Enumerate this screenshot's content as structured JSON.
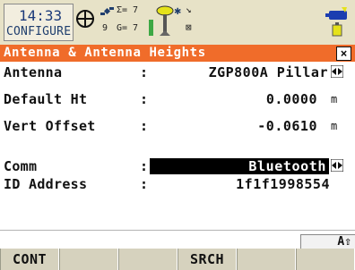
{
  "status": {
    "time": "14:33",
    "mode": "CONFIGURE",
    "satellites": {
      "gps_count_symbol": "Σ= 7",
      "glonass_count_symbol": "G= 7",
      "sv_number": "9"
    }
  },
  "title": {
    "text": "Antenna & Antenna Heights",
    "close_label": "×",
    "color": "#f06c2a"
  },
  "fields": {
    "antenna": {
      "label": "Antenna",
      "value": "ZGP800A Pillar"
    },
    "default_ht": {
      "label": "Default Ht",
      "value": "0.0000",
      "unit": "m"
    },
    "vert_offset": {
      "label": "Vert Offset",
      "value": "-0.0610",
      "unit": "m"
    },
    "comm": {
      "label": "Comm",
      "value": "Bluetooth"
    },
    "id_address": {
      "label": "ID Address",
      "value": "1f1f1998554"
    }
  },
  "colon": ":",
  "shift_indicator": "A⇧",
  "function_keys": [
    "CONT",
    "",
    "",
    "SRCH",
    "",
    ""
  ]
}
